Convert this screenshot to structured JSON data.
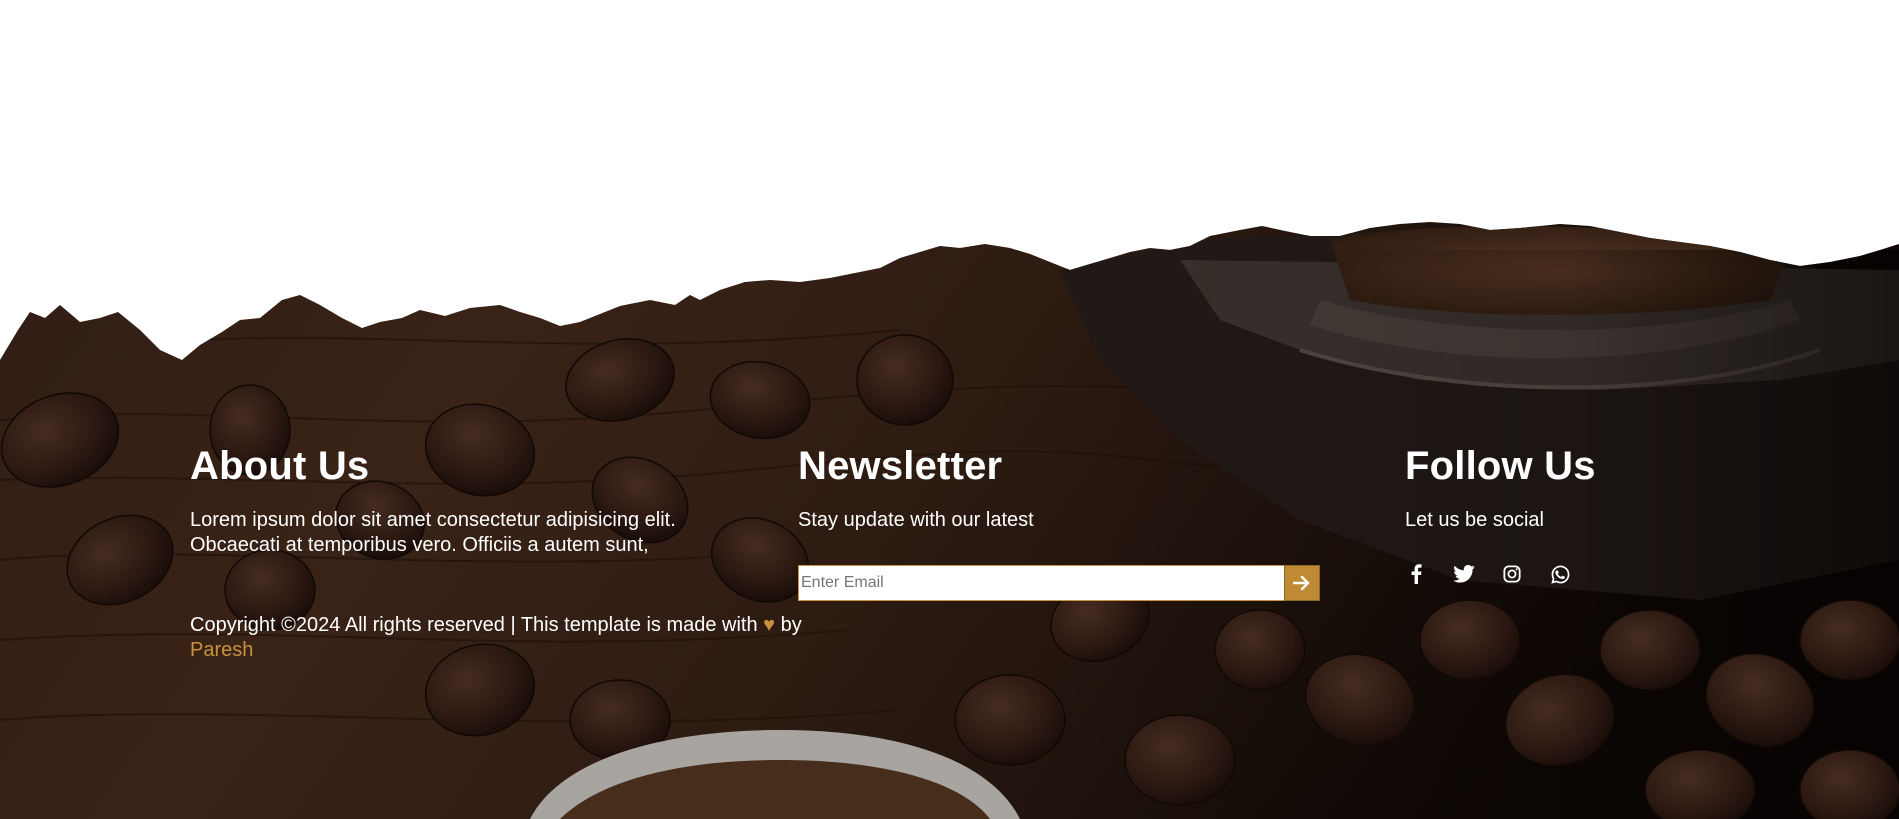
{
  "about": {
    "heading": "About Us",
    "text": "Lorem ipsum dolor sit amet consectetur adipisicing elit. Obcaecati at temporibus vero. Officiis a autem sunt,"
  },
  "newsletter": {
    "heading": "Newsletter",
    "text": "Stay update with our latest",
    "email_placeholder": "Enter Email",
    "submit_icon": "arrow-right-icon"
  },
  "follow": {
    "heading": "Follow Us",
    "text": "Let us be social",
    "icons": [
      "facebook-icon",
      "twitter-icon",
      "instagram-icon",
      "whatsapp-icon"
    ]
  },
  "copyright": {
    "prefix": "Copyright ©2024 All rights reserved | This template is made with",
    "heart": "♥",
    "by": "by",
    "author": "Paresh"
  },
  "colors": {
    "accent": "#c08a34",
    "text": "#ffffff",
    "background_top": "#ffffff",
    "background_footer": "#2b1a12"
  }
}
